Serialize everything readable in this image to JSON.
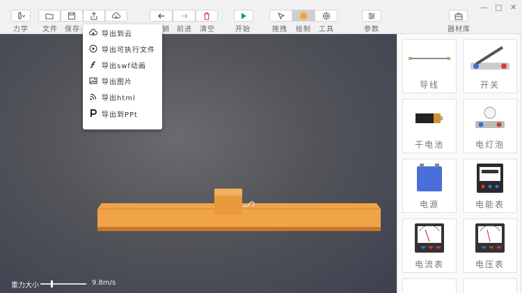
{
  "toolbar": {
    "mode_label": "力学",
    "file_label": "文件",
    "save_label": "保存",
    "undo_label": "撤销",
    "undo_visible_label": "销",
    "redo_label": "前进",
    "clear_label": "清空",
    "start_label": "开始",
    "drag_label": "拖拽",
    "draw_label": "绘制",
    "tools_label": "工具",
    "params_label": "参数",
    "library_label": "器材库"
  },
  "window": {
    "minimize": "—",
    "maximize": "□",
    "close": "✕"
  },
  "export_menu": {
    "items": [
      {
        "label": "导出到云",
        "icon": "cloud-upload-icon"
      },
      {
        "label": "导出可执行文件",
        "icon": "play-circle-icon"
      },
      {
        "label": "导出swf动画",
        "icon": "flash-icon"
      },
      {
        "label": "导出图片",
        "icon": "image-icon"
      },
      {
        "label": "导出html",
        "icon": "rss-icon"
      },
      {
        "label": "导出到PPt",
        "icon": "powerpoint-icon"
      }
    ]
  },
  "canvas": {
    "gravity_label": "重力大小",
    "gravity_value": "9.8m/s",
    "gravity_fraction": 0.2
  },
  "library": {
    "items": [
      {
        "label": "导线",
        "icon": "wire-icon"
      },
      {
        "label": "开关",
        "icon": "switch-icon"
      },
      {
        "label": "干电池",
        "icon": "battery-icon"
      },
      {
        "label": "电灯泡",
        "icon": "bulb-icon"
      },
      {
        "label": "电源",
        "icon": "power-supply-icon"
      },
      {
        "label": "电能表",
        "icon": "energy-meter-icon"
      },
      {
        "label": "电流表",
        "icon": "ammeter-icon"
      },
      {
        "label": "电压表",
        "icon": "voltmeter-icon"
      }
    ]
  },
  "colors": {
    "accent_orange": "#f5a623",
    "clear_red": "#e03030",
    "start_green": "#2a9a3a",
    "board_orange": "#f0a347"
  }
}
